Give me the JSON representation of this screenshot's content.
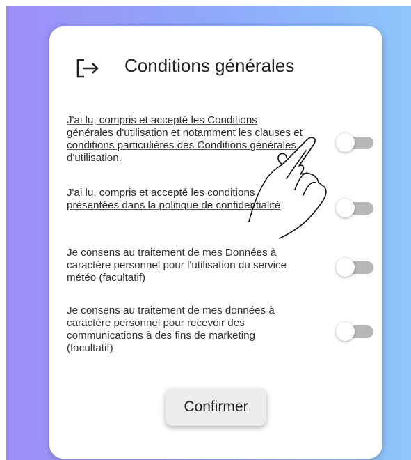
{
  "header": {
    "title": "Conditions générales",
    "icon": "logout-icon"
  },
  "consents": [
    {
      "text": "J'ai lu, compris et accepté les Conditions générales d'utilisation et notamment les clauses et conditions particulières des Conditions générales d'utilisation.",
      "link": true,
      "checked": false
    },
    {
      "text": "J'ai lu, compris et accepté les conditions présentées dans la politique de confidentialité",
      "link": true,
      "checked": false
    },
    {
      "text": "Je consens au traitement de mes Données à caractère personnel pour l'utilisation du service météo (facultatif)",
      "link": false,
      "checked": false
    },
    {
      "text": "Je consens au traitement de mes données à caractère personnel pour recevoir des communications à des fins de marketing (facultatif)",
      "link": false,
      "checked": false
    }
  ],
  "confirm_label": "Confirmer",
  "gesture": "tap-hand-icon"
}
